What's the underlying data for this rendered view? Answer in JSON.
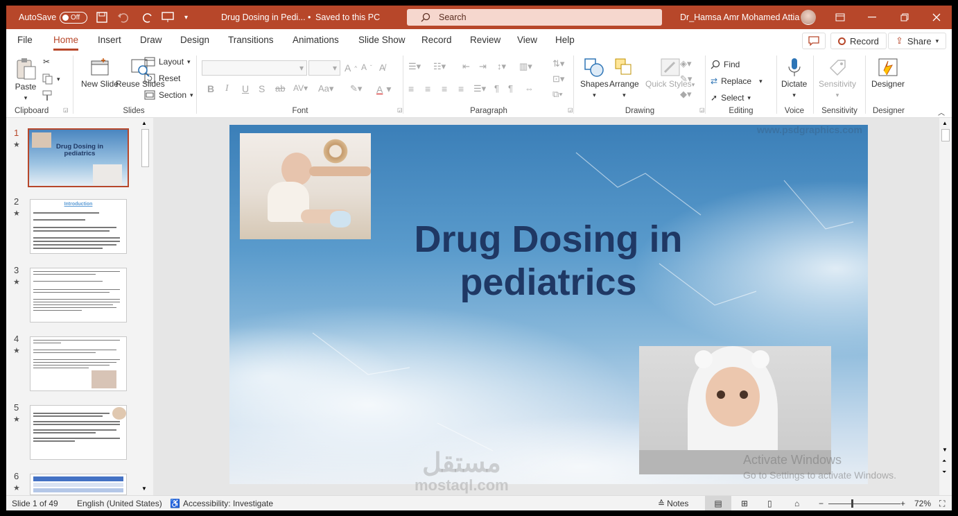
{
  "titlebar": {
    "autosave": "AutoSave",
    "autosave_state": "Off",
    "doc_title": "Drug Dosing in Pedi...",
    "save_status": "Saved to this PC",
    "search_placeholder": "Search",
    "user": "Dr_Hamsa Amr Mohamed Attia"
  },
  "tabs": [
    "File",
    "Home",
    "Insert",
    "Draw",
    "Design",
    "Transitions",
    "Animations",
    "Slide Show",
    "Record",
    "Review",
    "View",
    "Help"
  ],
  "active_tab": "Home",
  "tab_buttons": {
    "record": "Record",
    "share": "Share"
  },
  "ribbon": {
    "clipboard": {
      "paste": "Paste",
      "label": "Clipboard"
    },
    "slides": {
      "new_slide": "New Slide",
      "reuse_slides": "Reuse Slides",
      "layout": "Layout",
      "reset": "Reset",
      "section": "Section",
      "label": "Slides"
    },
    "font": {
      "label": "Font"
    },
    "paragraph": {
      "label": "Paragraph"
    },
    "drawing": {
      "shapes": "Shapes",
      "arrange": "Arrange",
      "quick_styles": "Quick Styles",
      "label": "Drawing"
    },
    "editing": {
      "find": "Find",
      "replace": "Replace",
      "select": "Select",
      "label": "Editing"
    },
    "voice": {
      "dictate": "Dictate",
      "label": "Voice"
    },
    "sensitivity": {
      "button": "Sensitivity",
      "label": "Sensitivity"
    },
    "designer": {
      "button": "Designer",
      "label": "Designer"
    }
  },
  "thumbnails": [
    {
      "num": "1",
      "title": "Drug Dosing in pediatrics"
    },
    {
      "num": "2",
      "title": "Introduction"
    },
    {
      "num": "3"
    },
    {
      "num": "4"
    },
    {
      "num": "5"
    },
    {
      "num": "6"
    }
  ],
  "slide": {
    "title": "Drug Dosing in pediatrics",
    "watermark": "www.psdgraphics.com"
  },
  "overlay": {
    "activate_line1": "Activate Windows",
    "activate_line2": "Go to Settings to activate Windows.",
    "mostaql_ar": "مستقل",
    "mostaql_en": "mostaql.com"
  },
  "status": {
    "slide_count": "Slide 1 of 49",
    "language": "English (United States)",
    "accessibility": "Accessibility: Investigate",
    "notes": "Notes",
    "zoom": "72%"
  }
}
